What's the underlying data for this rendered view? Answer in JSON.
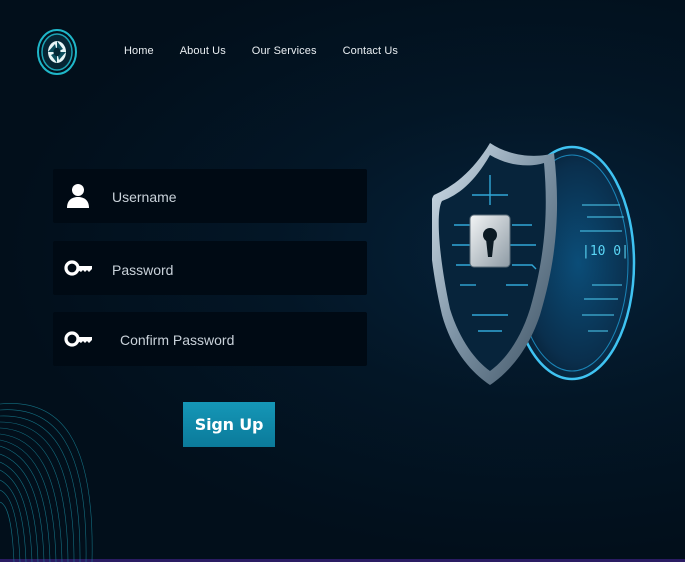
{
  "nav": {
    "items": [
      {
        "label": "Home"
      },
      {
        "label": "About Us"
      },
      {
        "label": "Our Services"
      },
      {
        "label": "Contact Us"
      }
    ]
  },
  "form": {
    "username_placeholder": "Username",
    "password_placeholder": "Password",
    "confirm_placeholder": "Confirm Password",
    "submit_label": "Sign Up"
  },
  "colors": {
    "background": "#02101c",
    "field_bg": "#000a14",
    "accent": "#1597b7",
    "cyan_glow": "#38c8f0"
  },
  "icons": {
    "logo": "aperture-logo-icon",
    "username": "user-icon",
    "password": "key-icon",
    "confirm": "key-icon",
    "illustration": "shield-lock-icon"
  }
}
